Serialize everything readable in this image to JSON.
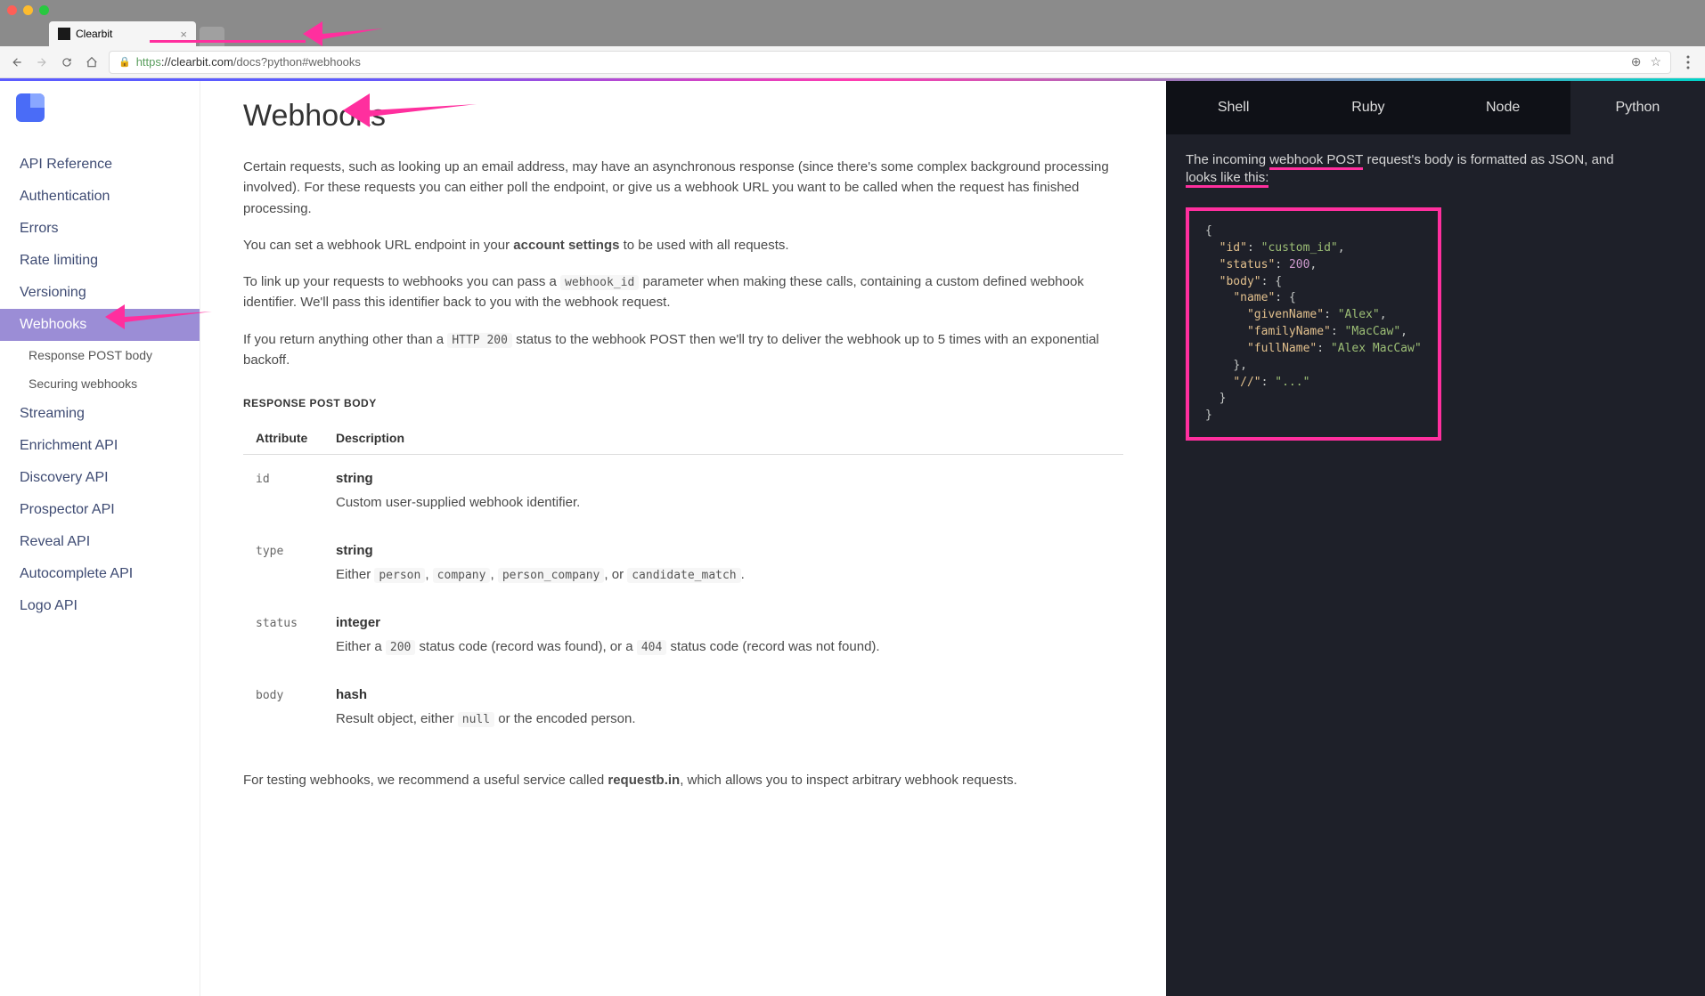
{
  "browser": {
    "tab_title": "Clearbit",
    "url_full": "https://clearbit.com/docs?python#webhooks",
    "url_domain": "clearbit.com",
    "url_path": "/docs?python#webhooks"
  },
  "sidebar": {
    "items": [
      {
        "label": "API Reference",
        "active": false
      },
      {
        "label": "Authentication",
        "active": false
      },
      {
        "label": "Errors",
        "active": false
      },
      {
        "label": "Rate limiting",
        "active": false
      },
      {
        "label": "Versioning",
        "active": false
      },
      {
        "label": "Webhooks",
        "active": true,
        "subitems": [
          {
            "label": "Response POST body"
          },
          {
            "label": "Securing webhooks"
          }
        ]
      },
      {
        "label": "Streaming",
        "active": false
      },
      {
        "label": "Enrichment API",
        "active": false
      },
      {
        "label": "Discovery API",
        "active": false
      },
      {
        "label": "Prospector API",
        "active": false
      },
      {
        "label": "Reveal API",
        "active": false
      },
      {
        "label": "Autocomplete API",
        "active": false
      },
      {
        "label": "Logo API",
        "active": false
      }
    ]
  },
  "main": {
    "title": "Webhooks",
    "p1": "Certain requests, such as looking up an email address, may have an asynchronous response (since there's some complex background processing involved). For these requests you can either poll the endpoint, or give us a webhook URL you want to be called when the request has finished processing.",
    "p2_a": "You can set a webhook URL endpoint in your ",
    "p2_b": "account settings",
    "p2_c": " to be used with all requests.",
    "p3_a": "To link up your requests to webhooks you can pass a ",
    "p3_code": "webhook_id",
    "p3_b": " parameter when making these calls, containing a custom defined webhook identifier. We'll pass this identifier back to you with the webhook request.",
    "p4_a": "If you return anything other than a ",
    "p4_code": "HTTP 200",
    "p4_b": " status to the webhook POST then we'll try to deliver the webhook up to 5 times with an exponential backoff.",
    "section_label": "RESPONSE POST BODY",
    "table": {
      "headers": {
        "attr": "Attribute",
        "desc": "Description"
      },
      "rows": [
        {
          "name": "id",
          "type": "string",
          "desc": "Custom user-supplied webhook identifier."
        },
        {
          "name": "type",
          "type": "string",
          "desc_a": "Either ",
          "codes": [
            "person",
            "company",
            "person_company",
            "candidate_match"
          ],
          "desc_b": "."
        },
        {
          "name": "status",
          "type": "integer",
          "desc_a": "Either a ",
          "code1": "200",
          "desc_b": " status code (record was found), or a ",
          "code2": "404",
          "desc_c": " status code (record was not found)."
        },
        {
          "name": "body",
          "type": "hash",
          "desc_a": "Result object, either ",
          "code1": "null",
          "desc_b": " or the encoded person."
        }
      ]
    },
    "p5_a": "For testing webhooks, we recommend a useful service called ",
    "p5_b": "requestb.in",
    "p5_c": ", which allows you to inspect arbitrary webhook requests."
  },
  "code": {
    "langs": [
      "Shell",
      "Ruby",
      "Node",
      "Python"
    ],
    "active_lang": "Python",
    "desc_a": "The incoming ",
    "desc_hl1": "webhook POST",
    "desc_b": " request's body is formatted as JSON, and ",
    "desc_hl2": "looks like this:",
    "json": {
      "id": "custom_id",
      "status": 200,
      "name_given": "Alex",
      "name_family": "MacCaw",
      "name_full": "Alex MacCaw",
      "ellipsis": "..."
    }
  }
}
